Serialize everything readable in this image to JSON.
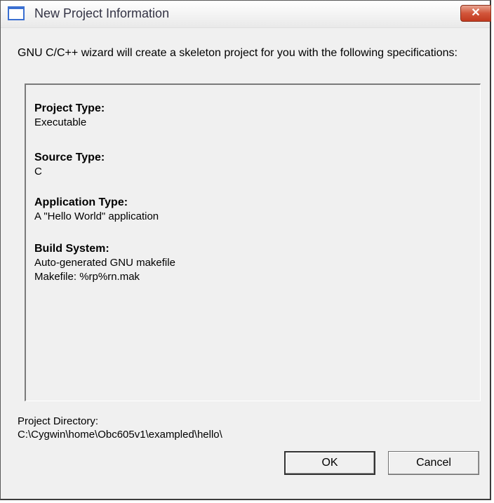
{
  "window": {
    "title": "New Project Information"
  },
  "intro": "GNU C/C++ wizard will create a skeleton project for you with the following specifications:",
  "sections": [
    {
      "heading": "Project Type:",
      "lines": [
        "Executable"
      ]
    },
    {
      "heading": "Source Type:",
      "lines": [
        "C"
      ]
    },
    {
      "heading": "Application Type:",
      "lines": [
        "A \"Hello World\" application"
      ]
    },
    {
      "heading": "Build System:",
      "lines": [
        "Auto-generated GNU makefile",
        "Makefile: %rp%rn.mak"
      ]
    }
  ],
  "project_directory": {
    "label": "Project Directory:",
    "value": "C:\\Cygwin\\home\\Obc605v1\\exampled\\hello\\"
  },
  "buttons": {
    "ok": "OK",
    "cancel": "Cancel"
  },
  "icons": {
    "title": "window-icon",
    "close": "close-icon"
  },
  "colors": {
    "close_button": "#d2553a",
    "title_icon": "#3a6fd1"
  }
}
